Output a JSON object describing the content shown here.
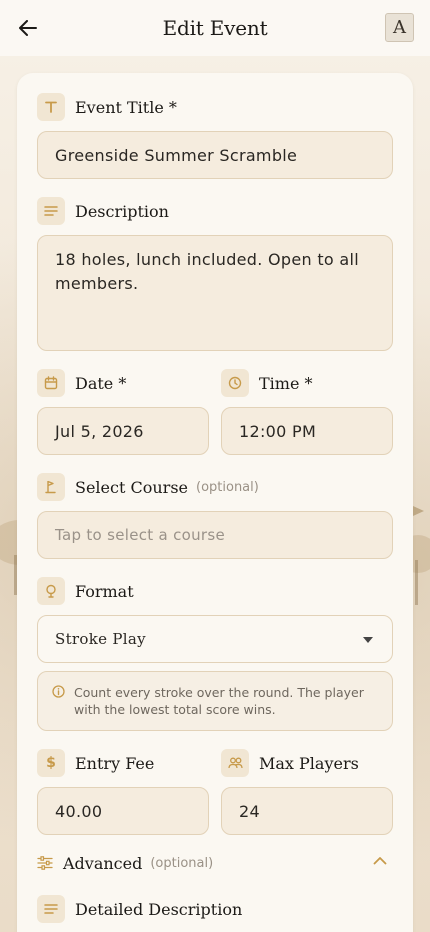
{
  "header": {
    "title": "Edit Event",
    "avatar_letter": "A"
  },
  "fields": {
    "event_title": {
      "label": "Event Title *",
      "value": "Greenside Summer Scramble"
    },
    "description": {
      "label": "Description",
      "value": "18 holes, lunch included. Open to all members."
    },
    "date": {
      "label": "Date *",
      "value": "Jul 5, 2026"
    },
    "time": {
      "label": "Time *",
      "value": "12:00 PM"
    },
    "course": {
      "label": "Select Course",
      "optional": "(optional)",
      "placeholder": "Tap to select a course"
    },
    "format": {
      "label": "Format",
      "value": "Stroke Play",
      "info": "Count every stroke over the round. The player with the lowest total score wins."
    },
    "entry_fee": {
      "label": "Entry Fee",
      "value": "40.00"
    },
    "max_players": {
      "label": "Max Players",
      "value": "24"
    }
  },
  "advanced": {
    "label": "Advanced",
    "optional": "(optional)",
    "expanded": true
  },
  "detailed_description": {
    "label": "Detailed Description"
  },
  "colors": {
    "accent": "#c79a4a",
    "field_bg": "#f5ecde",
    "icon_bg": "#f1e6d3"
  }
}
